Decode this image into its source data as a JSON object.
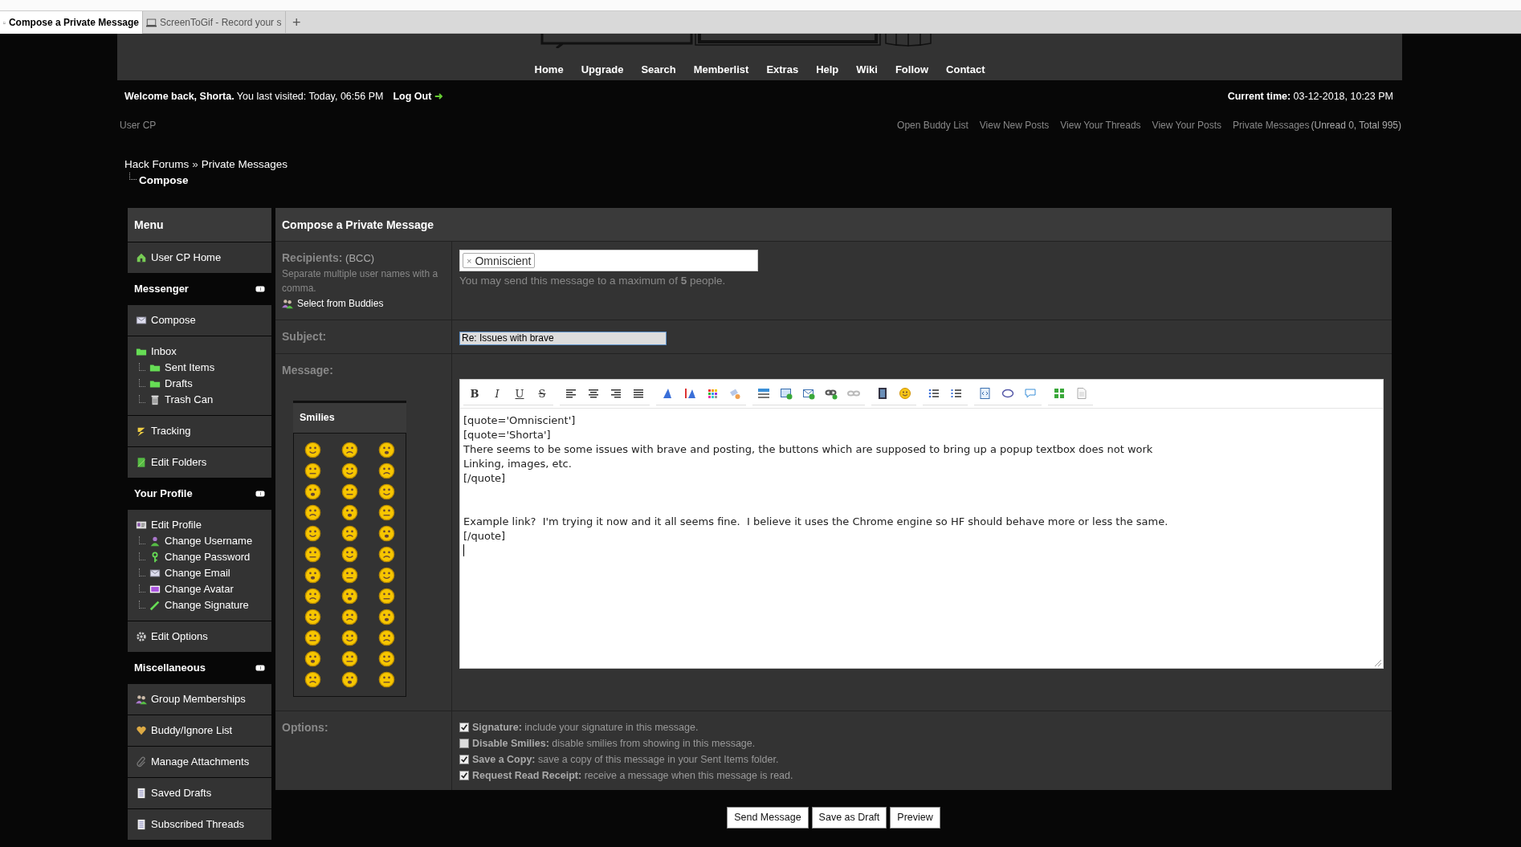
{
  "browser_tabs": [
    {
      "title": "Compose a Private Message",
      "selected": true
    },
    {
      "title": "ScreenToGif - Record your s",
      "selected": false
    }
  ],
  "new_tab": "+",
  "nav": [
    "Home",
    "Upgrade",
    "Search",
    "Memberlist",
    "Extras",
    "Help",
    "Wiki",
    "Follow",
    "Contact"
  ],
  "welcome": "**Welcome back, Shorta.** You last visited: Today, 06:56 PM",
  "logout": "Log Out",
  "current_time": "**Current time:** 03-12-2018, 10:23 PM",
  "usercp_label": "User CP",
  "quick_links": [
    "Open Buddy List",
    "View New Posts",
    "View Your Threads",
    "View Your Posts",
    "Private Messages"
  ],
  "pm_counts": "(Unread 0, Total 995)",
  "breadcrumb": {
    "path": [
      "Hack Forums",
      "Private Messages"
    ],
    "separator": "»",
    "current": "Compose"
  },
  "sidebar": {
    "title": "Menu",
    "blocks": [
      {
        "kind": "links",
        "items": [
          {
            "label": "User CP Home",
            "kind": "home"
          }
        ]
      },
      {
        "kind": "heading",
        "label": "Messenger",
        "expanded": true
      },
      {
        "kind": "links",
        "items": [
          {
            "label": "Compose",
            "kind": "envelope"
          }
        ]
      },
      {
        "kind": "links",
        "items": [
          {
            "label": "Inbox",
            "kind": "folder",
            "children": [
              {
                "label": "Sent Items",
                "kind": "folder"
              },
              {
                "label": "Drafts",
                "kind": "folder"
              },
              {
                "label": "Trash Can",
                "kind": "trash"
              }
            ]
          }
        ]
      },
      {
        "kind": "links",
        "items": [
          {
            "label": "Tracking",
            "kind": "tracking"
          }
        ]
      },
      {
        "kind": "links",
        "items": [
          {
            "label": "Edit Folders",
            "kind": "book"
          }
        ]
      },
      {
        "kind": "heading",
        "label": "Your Profile",
        "expanded": true
      },
      {
        "kind": "links",
        "items": [
          {
            "label": "Edit Profile",
            "kind": "card",
            "children": [
              {
                "label": "Change Username",
                "kind": "user"
              },
              {
                "label": "Change Password",
                "kind": "key"
              },
              {
                "label": "Change Email",
                "kind": "envelope"
              },
              {
                "label": "Change Avatar",
                "kind": "avatar"
              },
              {
                "label": "Change Signature",
                "kind": "pencil"
              }
            ]
          }
        ]
      },
      {
        "kind": "links",
        "items": [
          {
            "label": "Edit Options",
            "kind": "gear"
          }
        ]
      },
      {
        "kind": "heading",
        "label": "Miscellaneous",
        "expanded": true
      },
      {
        "kind": "links",
        "items": [
          {
            "label": "Group Memberships",
            "kind": "group"
          }
        ]
      },
      {
        "kind": "links",
        "items": [
          {
            "label": "Buddy/Ignore List",
            "kind": "heart"
          }
        ]
      },
      {
        "kind": "links",
        "items": [
          {
            "label": "Manage Attachments",
            "kind": "paperclip"
          }
        ]
      },
      {
        "kind": "links",
        "items": [
          {
            "label": "Saved Drafts",
            "kind": "page"
          }
        ]
      },
      {
        "kind": "links",
        "items": [
          {
            "label": "Subscribed Threads",
            "kind": "page"
          }
        ]
      }
    ]
  },
  "compose": {
    "title": "Compose a Private Message",
    "recipients": {
      "label": "Recipients:",
      "suffix": "(BCC)",
      "hint": "Separate multiple user names with a comma.",
      "buddies_link": "Select from Buddies",
      "tags": [
        {
          "name": "Omniscient",
          "remove": "×"
        }
      ],
      "limit_note": "You may send this message to a maximum of **5** people."
    },
    "subject": {
      "label": "Subject:",
      "value": "Re: Issues with brave"
    },
    "message": {
      "label": "Message:",
      "smilies_title": "Smilies",
      "toolbar": [
        [
          {
            "kind": "bold",
            "label": "B"
          },
          {
            "kind": "italic",
            "label": "I"
          },
          {
            "kind": "underline",
            "label": "U"
          },
          {
            "kind": "strike",
            "label": "S"
          }
        ],
        [
          {
            "kind": "left"
          },
          {
            "kind": "center"
          },
          {
            "kind": "right"
          },
          {
            "kind": "justify"
          }
        ],
        [
          {
            "kind": "font"
          },
          {
            "kind": "size"
          },
          {
            "kind": "color"
          },
          {
            "kind": "eraser"
          }
        ],
        [
          {
            "kind": "rule"
          },
          {
            "kind": "image"
          },
          {
            "kind": "email"
          },
          {
            "kind": "link"
          },
          {
            "kind": "unlink"
          }
        ],
        [
          {
            "kind": "video"
          },
          {
            "kind": "emoticon"
          }
        ],
        [
          {
            "kind": "bullets"
          },
          {
            "kind": "numbers"
          }
        ],
        [
          {
            "kind": "code"
          },
          {
            "kind": "php"
          },
          {
            "kind": "quote"
          }
        ],
        [
          {
            "kind": "maximize"
          },
          {
            "kind": "source"
          }
        ]
      ],
      "value": "[quote='Omniscient']\n[quote='Shorta']\nThere seems to be some issues with brave and posting, the buttons which are supposed to bring up a popup textbox does not work\nLinking, images, etc.\n[/quote]\n\n\nExample link?  I'm trying it now and it all seems fine.  I believe it uses the Chrome engine so HF should behave more or less the same.\n[/quote]"
    },
    "options": {
      "label": "Options:",
      "items": [
        {
          "label": "Signature:",
          "text": "include your signature in this message.",
          "checked": true
        },
        {
          "label": "Disable Smilies:",
          "text": "disable smilies from showing in this message.",
          "checked": false
        },
        {
          "label": "Save a Copy:",
          "text": "save a copy of this message in your Sent Items folder.",
          "checked": true
        },
        {
          "label": "Request Read Receipt:",
          "text": "receive a message when this message is read.",
          "checked": true
        }
      ]
    }
  },
  "buttons": [
    "Send Message",
    "Save as Draft",
    "Preview"
  ]
}
